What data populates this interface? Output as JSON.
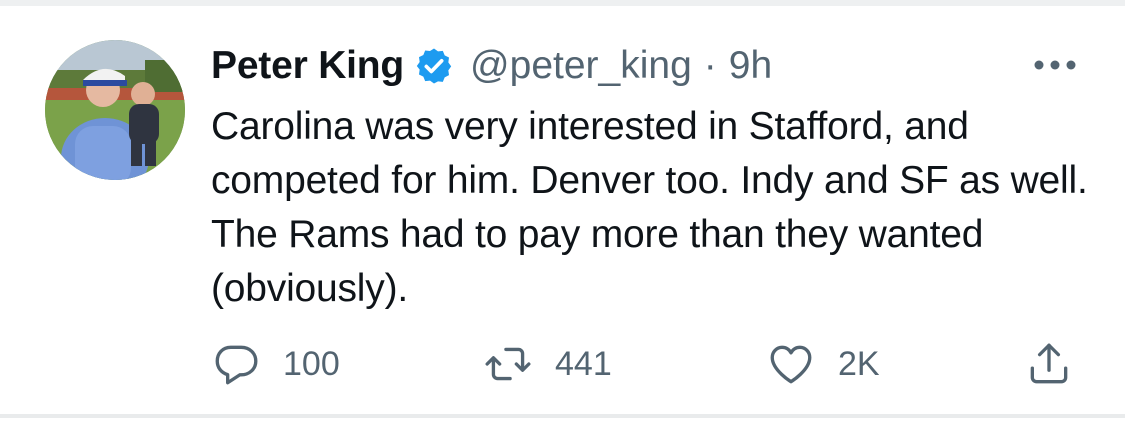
{
  "tweet": {
    "author_name": "Peter King",
    "handle": "@peter_king",
    "separator": "·",
    "time": "9h",
    "text": "Carolina was very interested in Stafford, and competed for him. Denver too. Indy and SF as well. The Rams had to pay more than they wanted (obviously).",
    "verified": true
  },
  "actions": {
    "reply_count": "100",
    "retweet_count": "441",
    "like_count": "2K"
  },
  "icons": {
    "verified": "verified-badge-icon",
    "more": "more-dots-icon",
    "reply": "reply-bubble-icon",
    "retweet": "retweet-icon",
    "like": "heart-icon",
    "share": "share-icon"
  },
  "colors": {
    "text": "#0f1419",
    "secondary": "#536471",
    "verified": "#1d9bf0"
  }
}
